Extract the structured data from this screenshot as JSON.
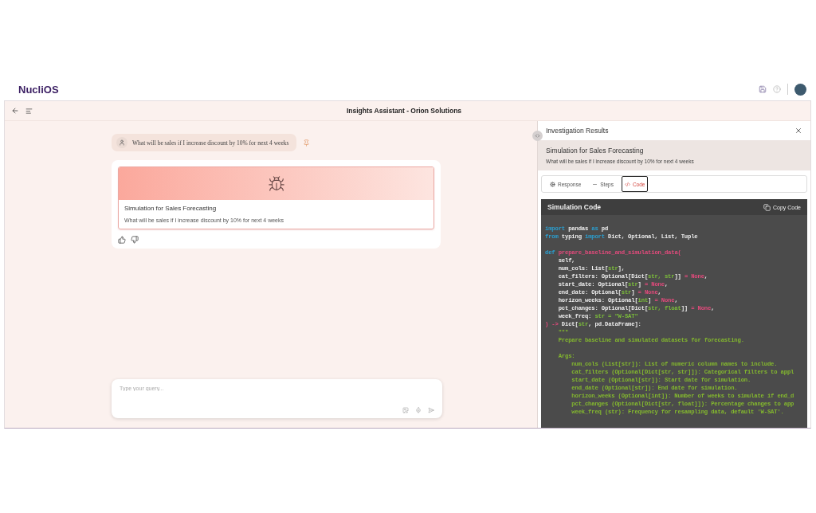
{
  "brand": "NucliOS",
  "title": "Insights Assistant - Orion Solutions",
  "chat": {
    "question": "What will be sales if I increase discount by 10% for next 4 weeks",
    "card": {
      "title": "Simulation for Sales Forecasting",
      "subtitle": "What will be sales if I increase discount by 10% for next 4 weeks"
    },
    "input": {
      "placeholder": "Type your query..."
    }
  },
  "panel": {
    "title": "Investigation Results",
    "heading": "Simulation for Sales Forecasting",
    "subheading": "What will be sales if I increase discount by 10% for next 4 weeks",
    "tabs": [
      {
        "label": "Response",
        "kind": "response",
        "selected": false
      },
      {
        "label": "Steps",
        "kind": "steps",
        "selected": false
      },
      {
        "label": "Code",
        "kind": "code",
        "selected": true
      }
    ],
    "code": {
      "title": "Simulation Code",
      "copy": "Copy Code",
      "lines": [
        {
          "tokens": [
            {
              "text": "import",
              "kind": "kw"
            },
            {
              "text": " pandas ",
              "kind": "id"
            },
            {
              "text": "as",
              "kind": "kw"
            },
            {
              "text": " pd",
              "kind": "id"
            }
          ]
        },
        {
          "tokens": [
            {
              "text": "from",
              "kind": "kw"
            },
            {
              "text": " typing ",
              "kind": "id"
            },
            {
              "text": "import",
              "kind": "kw"
            },
            {
              "text": " Dict, Optional, List, Tuple",
              "kind": "id"
            }
          ]
        },
        {
          "gap_before": true,
          "tokens": [
            {
              "text": "def",
              "kind": "kw"
            },
            {
              "text": " prepare_baseline_and_simulation_data(",
              "kind": "fn"
            }
          ]
        },
        {
          "tokens": [
            {
              "text": "    self,",
              "kind": "id"
            }
          ]
        },
        {
          "tokens": [
            {
              "text": "    num_cols: List[",
              "kind": "id"
            },
            {
              "text": "str",
              "kind": "ty"
            },
            {
              "text": "],",
              "kind": "id"
            }
          ]
        },
        {
          "tokens": [
            {
              "text": "    cat_filters: Optional[Dict[",
              "kind": "id"
            },
            {
              "text": "str, str",
              "kind": "ty"
            },
            {
              "text": "]] ",
              "kind": "id"
            },
            {
              "text": "= None",
              "kind": "op"
            },
            {
              "text": ",",
              "kind": "id"
            }
          ]
        },
        {
          "tokens": [
            {
              "text": "    start_date: Optional[",
              "kind": "id"
            },
            {
              "text": "str",
              "kind": "ty"
            },
            {
              "text": "] ",
              "kind": "id"
            },
            {
              "text": "= None",
              "kind": "op"
            },
            {
              "text": ",",
              "kind": "id"
            }
          ]
        },
        {
          "tokens": [
            {
              "text": "    end_date: Optional[",
              "kind": "id"
            },
            {
              "text": "str",
              "kind": "ty"
            },
            {
              "text": "] ",
              "kind": "id"
            },
            {
              "text": "= None",
              "kind": "op"
            },
            {
              "text": ",",
              "kind": "id"
            }
          ]
        },
        {
          "tokens": [
            {
              "text": "    horizon_weeks: Optional[",
              "kind": "id"
            },
            {
              "text": "int",
              "kind": "ty"
            },
            {
              "text": "] ",
              "kind": "id"
            },
            {
              "text": "= None",
              "kind": "op"
            },
            {
              "text": ",",
              "kind": "id"
            }
          ]
        },
        {
          "tokens": [
            {
              "text": "    pct_changes: Optional[Dict[",
              "kind": "id"
            },
            {
              "text": "str, float",
              "kind": "ty"
            },
            {
              "text": "]] ",
              "kind": "id"
            },
            {
              "text": "= None",
              "kind": "op"
            },
            {
              "text": ",",
              "kind": "id"
            }
          ]
        },
        {
          "tokens": [
            {
              "text": "    week_freq: ",
              "kind": "id"
            },
            {
              "text": "str = \"W-SAT\"",
              "kind": "ty"
            }
          ]
        },
        {
          "tokens": [
            {
              "text": ") -> ",
              "kind": "op"
            },
            {
              "text": "Dict[",
              "kind": "id"
            },
            {
              "text": "str",
              "kind": "ty"
            },
            {
              "text": ", pd.DataFrame]:",
              "kind": "id"
            }
          ]
        },
        {
          "tokens": [
            {
              "text": "    \"\"\"",
              "kind": "doc"
            }
          ]
        },
        {
          "tokens": [
            {
              "text": "    Prepare baseline and simulated datasets for forecasting.",
              "kind": "doc"
            }
          ]
        },
        {
          "gap_before": true,
          "tokens": [
            {
              "text": "    Args:",
              "kind": "doc"
            }
          ]
        },
        {
          "tokens": [
            {
              "text": "        num_cols (List[str]): List of numeric column names to include.",
              "kind": "doc"
            }
          ]
        },
        {
          "tokens": [
            {
              "text": "        cat_filters (Optional[Dict[str, str]]): Categorical filters to appl",
              "kind": "doc"
            }
          ]
        },
        {
          "tokens": [
            {
              "text": "        start_date (Optional[str]): Start date for simulation.",
              "kind": "doc"
            }
          ]
        },
        {
          "tokens": [
            {
              "text": "        end_date (Optional[str]): End date for simulation.",
              "kind": "doc"
            }
          ]
        },
        {
          "tokens": [
            {
              "text": "        horizon_weeks (Optional[int]): Number of weeks to simulate if end_d",
              "kind": "doc"
            }
          ]
        },
        {
          "tokens": [
            {
              "text": "        pct_changes (Optional[Dict[str, float]]): Percentage changes to app",
              "kind": "doc"
            }
          ]
        },
        {
          "tokens": [
            {
              "text": "        week_freq (str): Frequency for resampling data, default 'W-SAT'.",
              "kind": "doc"
            }
          ]
        }
      ]
    }
  }
}
